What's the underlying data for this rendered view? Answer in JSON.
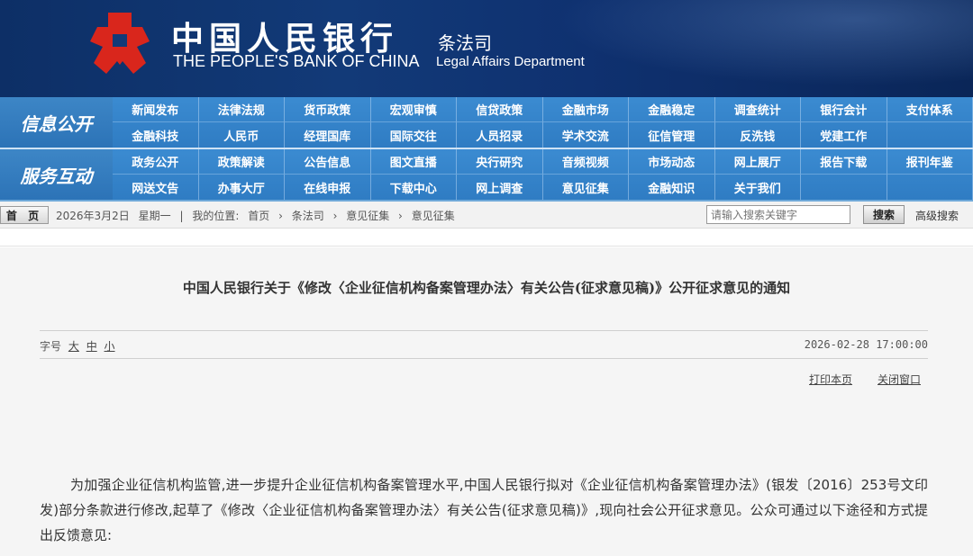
{
  "header": {
    "bank_name_cn": "中国人民银行",
    "bank_name_en": "THE PEOPLE'S BANK OF CHINA",
    "dept_cn": "条法司",
    "dept_en": "Legal Affairs Department"
  },
  "nav": {
    "group1": {
      "label": "信息公开",
      "row1": [
        "新闻发布",
        "法律法规",
        "货币政策",
        "宏观审慎",
        "信贷政策",
        "金融市场",
        "金融稳定",
        "调查统计",
        "银行会计",
        "支付体系"
      ],
      "row2": [
        "金融科技",
        "人民币",
        "经理国库",
        "国际交往",
        "人员招录",
        "学术交流",
        "征信管理",
        "反洗钱",
        "党建工作",
        ""
      ]
    },
    "group2": {
      "label": "服务互动",
      "row1": [
        "政务公开",
        "政策解读",
        "公告信息",
        "图文直播",
        "央行研究",
        "音频视频",
        "市场动态",
        "网上展厅",
        "报告下载",
        "报刊年鉴"
      ],
      "row2": [
        "网送文告",
        "办事大厅",
        "在线申报",
        "下载中心",
        "网上调查",
        "意见征集",
        "金融知识",
        "关于我们",
        "",
        ""
      ]
    }
  },
  "breadcrumb": {
    "home_label": "首 页",
    "date": "2026年3月2日",
    "weekday": "星期一",
    "separator": "|",
    "location_prefix": "我的位置:",
    "items": [
      "首页",
      "条法司",
      "意见征集",
      "意见征集"
    ],
    "arrow": "›"
  },
  "search": {
    "placeholder": "请输入搜索关键字",
    "button_label": "搜索",
    "advanced_label": "高级搜索"
  },
  "article": {
    "title": "中国人民银行关于《修改〈企业征信机构备案管理办法〉有关公告(征求意见稿)》公开征求意见的通知",
    "font_size_label": "字号",
    "font_size_options": [
      "大",
      "中",
      "小"
    ],
    "publish_time": "2026-02-28 17:00:00",
    "print_label": "打印本页",
    "close_label": "关闭窗口",
    "body": "为加强企业征信机构监管,进一步提升企业征信机构备案管理水平,中国人民银行拟对《企业征信机构备案管理办法》(银发〔2016〕253号文印发)部分条款进行修改,起草了《修改〈企业征信机构备案管理办法〉有关公告(征求意见稿)》,现向社会公开征求意见。公众可通过以下途径和方式提出反馈意见:"
  },
  "colors": {
    "banner": "#123a78",
    "nav_blue": "#3b8bd1",
    "logo_red": "#d9261c"
  }
}
